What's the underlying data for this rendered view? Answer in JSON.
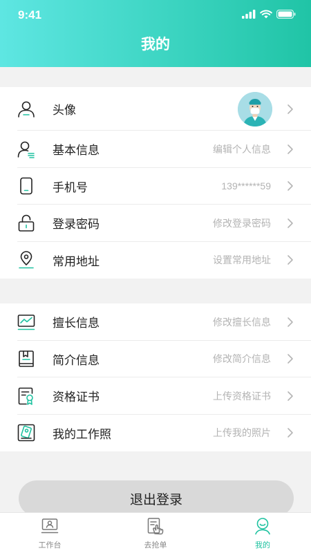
{
  "status_bar": {
    "time": "9:41"
  },
  "header": {
    "title": "我的"
  },
  "profile_group": [
    {
      "key": "avatar",
      "label": "头像",
      "value": "",
      "icon": "user-icon"
    },
    {
      "key": "basic",
      "label": "基本信息",
      "value": "编辑个人信息",
      "icon": "user-edit-icon"
    },
    {
      "key": "phone",
      "label": "手机号",
      "value": "139******59",
      "icon": "phone-icon"
    },
    {
      "key": "password",
      "label": "登录密码",
      "value": "修改登录密码",
      "icon": "lock-icon"
    },
    {
      "key": "address",
      "label": "常用地址",
      "value": "设置常用地址",
      "icon": "location-pin-icon"
    }
  ],
  "professional_group": [
    {
      "key": "specialty",
      "label": "擅长信息",
      "value": "修改擅长信息",
      "icon": "chart-board-icon"
    },
    {
      "key": "intro",
      "label": "简介信息",
      "value": "修改简介信息",
      "icon": "bookmark-doc-icon"
    },
    {
      "key": "certificate",
      "label": "资格证书",
      "value": "上传资格证书",
      "icon": "certificate-icon"
    },
    {
      "key": "photo",
      "label": "我的工作照",
      "value": "上传我的照片",
      "icon": "photo-frame-icon"
    }
  ],
  "logout": {
    "label": "退出登录"
  },
  "tabbar": {
    "tabs": [
      {
        "label": "工作台",
        "icon": "workbench-icon",
        "active": false
      },
      {
        "label": "去抢单",
        "icon": "grab-order-icon",
        "active": false
      },
      {
        "label": "我的",
        "icon": "profile-icon",
        "active": true
      }
    ]
  },
  "colors": {
    "accent": "#1fc2a0",
    "header_start": "#5ee6e2",
    "header_end": "#20c4a6"
  }
}
